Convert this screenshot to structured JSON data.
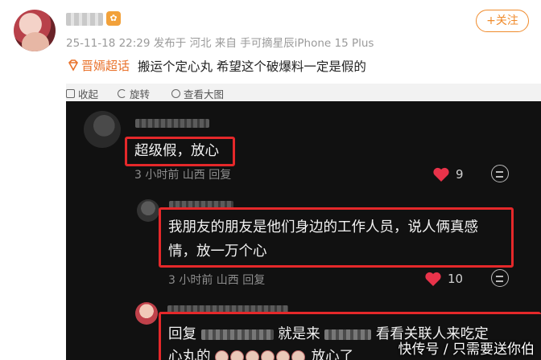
{
  "post": {
    "avatar_icon": "user-avatar",
    "vip_badge": "✿",
    "meta": "25-11-18 22:29 发布于 河北  来自 手可摘星辰iPhone 15 Plus",
    "follow_label": "+关注",
    "topic_icon": "diamond-topic-icon",
    "topic_name": "晋嫣超话",
    "text": "搬运个定心丸  希望这个破爆料一定是假的"
  },
  "toolbar": {
    "collapse": "收起",
    "rotate": "旋转",
    "view_large": "查看大图"
  },
  "comments": [
    {
      "text": "超级假，放心",
      "meta": "3 小时前  山西    回复",
      "likes": "9"
    },
    {
      "text_line1": "我朋友的朋友是他们身边的工作人员，说人俩真感",
      "text_line2": "情，放一万个心",
      "meta": "3 小时前  山西    回复",
      "likes": "10"
    },
    {
      "prefix": "回复",
      "middle": "就是来",
      "suffix": "看看关联人来吃定",
      "line2_start": "心丸的",
      "line2_end": "放心了"
    }
  ],
  "colors": {
    "accent": "#f08b2c",
    "highlight": "#e5282a",
    "like": "#e8334a"
  },
  "watermark": "快传号 / 只需要送你伯"
}
